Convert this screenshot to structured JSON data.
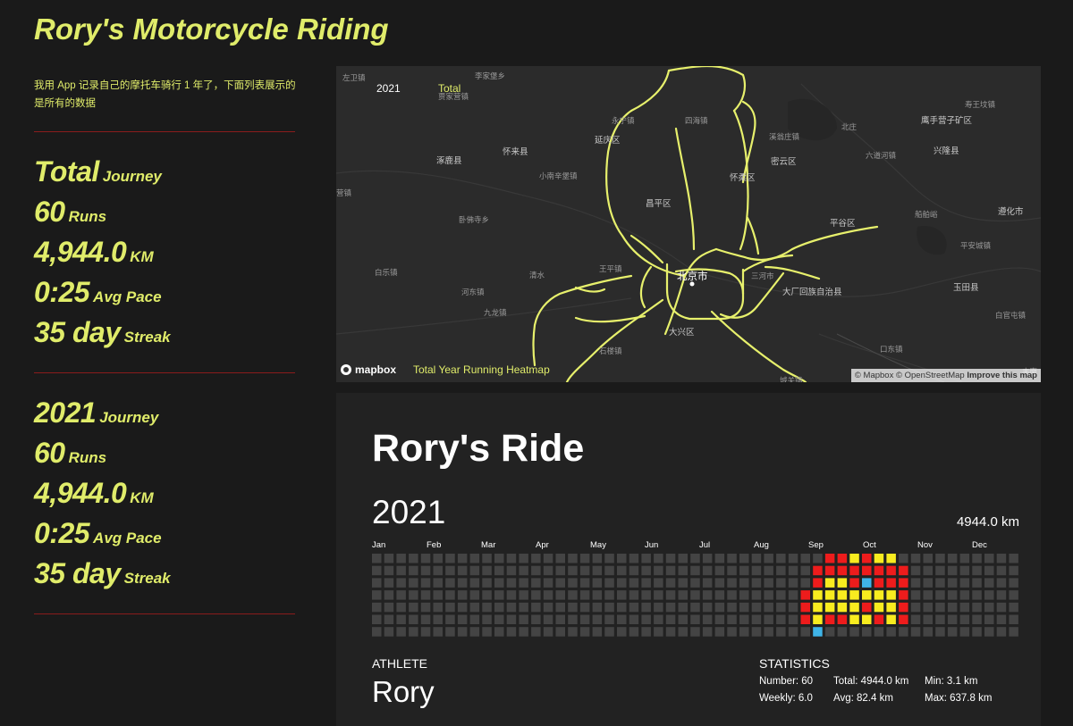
{
  "site": {
    "title": "Rory's Motorcycle Riding",
    "description": "我用 App 记录自己的摩托车骑行 1 年了，下面列表展示的是所有的数据"
  },
  "summaries": [
    {
      "label": "Total",
      "label_unit": "Journey",
      "runs": "60",
      "runs_unit": "Runs",
      "distance": "4,944.0",
      "distance_unit": "KM",
      "pace": "0:25",
      "pace_unit": "Avg Pace",
      "streak": "35 day",
      "streak_unit": "Streak"
    },
    {
      "label": "2021",
      "label_unit": "Journey",
      "runs": "60",
      "runs_unit": "Runs",
      "distance": "4,944.0",
      "distance_unit": "KM",
      "pace": "0:25",
      "pace_unit": "Avg Pace",
      "streak": "35 day",
      "streak_unit": "Streak"
    }
  ],
  "map": {
    "year_label": "2021",
    "total_label": "Total",
    "heatmap_label": "Total Year Running Heatmap",
    "logo_text": "mapbox",
    "attribution": "© Mapbox © OpenStreetMap",
    "improve_link": "Improve this map",
    "route_color": "#e7f06c",
    "places": [
      {
        "name": "左卫镇",
        "minor": true
      },
      {
        "name": "李家堡乡",
        "minor": true
      },
      {
        "name": "贾家营镇",
        "minor": true
      },
      {
        "name": "永宁镇",
        "minor": true
      },
      {
        "name": "四海镇",
        "minor": true
      },
      {
        "name": "寿王坟镇",
        "minor": true
      },
      {
        "name": "鹰手营子矿区",
        "minor": false
      },
      {
        "name": "北庄",
        "minor": true
      },
      {
        "name": "溪翁庄镇",
        "minor": true
      },
      {
        "name": "延庆区",
        "minor": false
      },
      {
        "name": "怀来县",
        "minor": false
      },
      {
        "name": "涿鹿县",
        "minor": false
      },
      {
        "name": "兴隆县",
        "minor": false
      },
      {
        "name": "六道河镇",
        "minor": true
      },
      {
        "name": "密云区",
        "minor": false
      },
      {
        "name": "怀柔区",
        "minor": false
      },
      {
        "name": "小南辛堡镇",
        "minor": true
      },
      {
        "name": "营镇",
        "minor": true
      },
      {
        "name": "昌平区",
        "minor": false
      },
      {
        "name": "卧佛寺乡",
        "minor": true
      },
      {
        "name": "平谷区",
        "minor": false
      },
      {
        "name": "船舶峪",
        "minor": true
      },
      {
        "name": "遵化市",
        "minor": false
      },
      {
        "name": "平安城镇",
        "minor": true
      },
      {
        "name": "白乐镇",
        "minor": true
      },
      {
        "name": "王平镇",
        "minor": true
      },
      {
        "name": "清水",
        "minor": true
      },
      {
        "name": "北京市",
        "minor": false
      },
      {
        "name": "河东镇",
        "minor": true
      },
      {
        "name": "三河市",
        "minor": true
      },
      {
        "name": "大厂回族自治县",
        "minor": false
      },
      {
        "name": "玉田县",
        "minor": false
      },
      {
        "name": "九龙镇",
        "minor": true
      },
      {
        "name": "白官屯镇",
        "minor": true
      },
      {
        "name": "大兴区",
        "minor": false
      },
      {
        "name": "石楼镇",
        "minor": true
      },
      {
        "name": "口东镇",
        "minor": true
      },
      {
        "name": "丰南",
        "minor": true
      },
      {
        "name": "城关镇",
        "minor": true
      }
    ]
  },
  "poster": {
    "title": "Rory's Ride",
    "year": "2021",
    "total_distance": "4944.0 km",
    "months": [
      "Jan",
      "Feb",
      "Mar",
      "Apr",
      "May",
      "Jun",
      "Jul",
      "Aug",
      "Sep",
      "Oct",
      "Nov",
      "Dec"
    ],
    "athlete_label": "ATHLETE",
    "athlete_name": "Rory",
    "statistics_label": "STATISTICS",
    "stats": {
      "number": "Number: 60",
      "weekly": "Weekly: 6.0",
      "total": "Total: 4944.0 km",
      "avg": "Avg: 82.4 km",
      "min": "Min: 3.1 km",
      "max": "Max: 637.8 km"
    },
    "colors": {
      "empty": "#444444",
      "red": "#ee1c1c",
      "yellow": "#f8ec1f",
      "blue": "#3fb4e8"
    },
    "calendar": {
      "weeks": 53,
      "days_per_week": 7,
      "first_active_week": 35,
      "last_active_week": 43,
      "active_columns": [
        "EEERRRE",
        "ERRYYYB",
        "RRYYYRE",
        "RRYYYRE",
        "YRRYYYE",
        "RRBYRYE",
        "YRRYYRE",
        "YRRYYYE",
        "ERRRRRE"
      ]
    }
  }
}
